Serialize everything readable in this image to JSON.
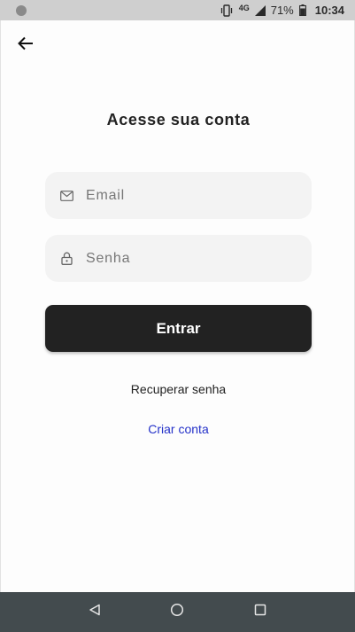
{
  "status_bar": {
    "network_label": "4G",
    "battery_percent": "71%",
    "time": "10:34",
    "icons": [
      "notification-dot-icon",
      "vibrate-icon",
      "signal-icon",
      "battery-icon"
    ]
  },
  "header": {
    "back_icon": "arrow-left-icon",
    "title": "Acesse sua conta"
  },
  "form": {
    "email": {
      "placeholder": "Email",
      "value": "",
      "icon": "mail-icon"
    },
    "password": {
      "placeholder": "Senha",
      "value": "",
      "icon": "lock-icon"
    },
    "submit_label": "Entrar",
    "recover_label": "Recuperar senha",
    "create_account_label": "Criar conta"
  },
  "nav_bar": {
    "icons": [
      "back-triangle-icon",
      "home-circle-icon",
      "recents-square-icon"
    ]
  },
  "colors": {
    "button_bg": "#222222",
    "link_blue": "#2431c9",
    "field_bg": "#f3f3f3",
    "nav_bg": "#434b4e"
  }
}
